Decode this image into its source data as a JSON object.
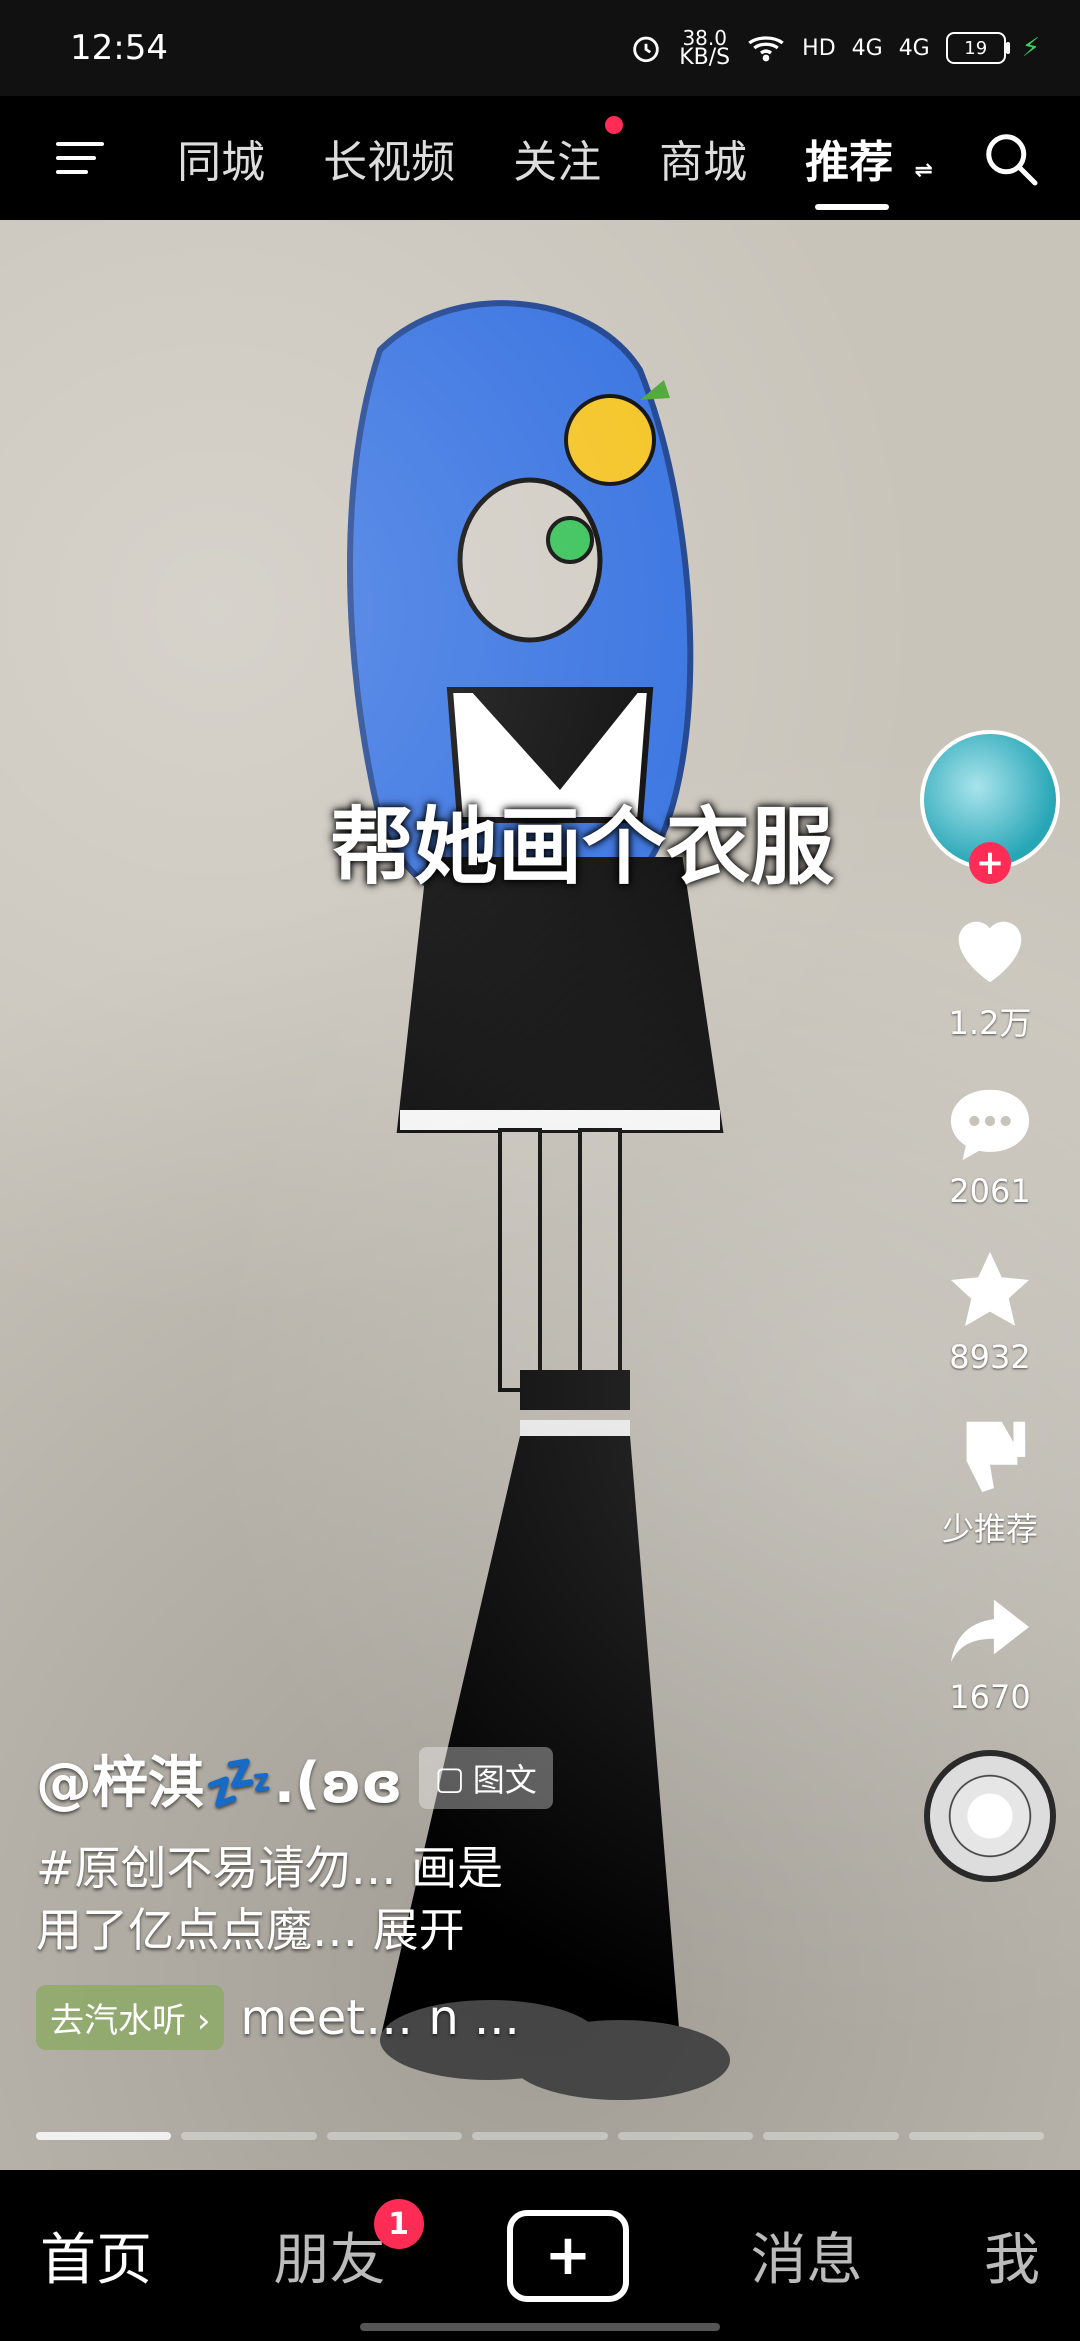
{
  "status": {
    "time": "12:54",
    "net_speed_value": "38.0",
    "net_speed_unit": "KB/S",
    "hd": "HD",
    "signal1": "4G",
    "signal2": "4G",
    "battery": "19"
  },
  "top_nav": {
    "tabs": [
      {
        "label": "同城"
      },
      {
        "label": "长视频"
      },
      {
        "label": "关注"
      },
      {
        "label": "商城"
      },
      {
        "label": "推荐"
      }
    ]
  },
  "post": {
    "author": "@梓淇💤.(ʚɞ",
    "badge": "图文",
    "description_line1": "#原创不易请勿… 画是",
    "description_line2": "用了亿点点魔… 展开",
    "overlay_caption": "帮她画个衣服",
    "music_chip": "去汽水听",
    "music_title": "meet… n ..."
  },
  "actions": {
    "likes": "1.2万",
    "comments": "2061",
    "favorites": "8932",
    "dislike": "少推荐",
    "shares": "1670"
  },
  "bottom_nav": {
    "home": "首页",
    "friends": "朋友",
    "friends_badge": "1",
    "messages": "消息",
    "me": "我"
  },
  "colors": {
    "accent": "#ff2d55",
    "bg_content": "#c9c4ba",
    "text_primary": "#ffffff"
  },
  "icons": [
    "menu-icon",
    "search-icon",
    "heart-icon",
    "comment-icon",
    "star-icon",
    "dislike-icon",
    "share-icon",
    "plus-icon",
    "image-text-icon",
    "alarm-icon",
    "wifi-icon",
    "battery-icon",
    "charging-icon"
  ]
}
